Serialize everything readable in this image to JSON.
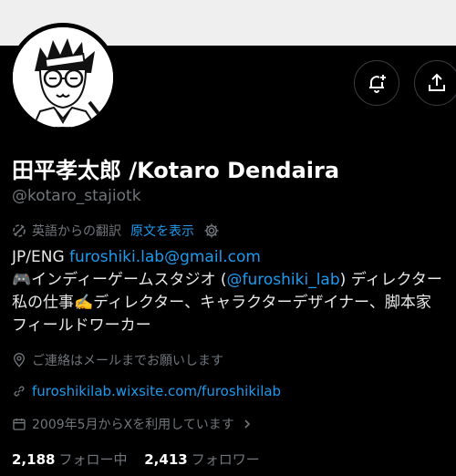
{
  "profile": {
    "display_name": "田平孝太郎 /Kotaro Dendaira",
    "handle": "@kotaro_stajiotk",
    "translation_note": "英語からの翻訳",
    "show_original": "原文を表示",
    "bio": {
      "line1_prefix": "JP/ENG ",
      "line1_email": "furoshiki.lab@gmail.com",
      "line2_prefix": "🎮インディーゲームスタジオ (",
      "line2_mention": "@furoshiki_lab",
      "line2_suffix": ") ディレクター",
      "line3": "私の仕事✍️ディレクター、キャラクターデザイナー、脚本家",
      "line4": "フィールドワーカー"
    },
    "location": "ご連絡はメールまでお願いします",
    "website": "furoshikilab.wixsite.com/furoshikilab",
    "joined": "2009年5月からXを利用しています",
    "following_count": "2,188",
    "following_label": "フォロー中",
    "followers_count": "2,413",
    "followers_label": "フォロワー"
  },
  "icons": {
    "notify": "bell-plus-icon",
    "share": "share-icon",
    "translate": "translate-icon",
    "settings": "gear-icon",
    "location": "location-pin-icon",
    "link": "link-icon",
    "calendar": "calendar-icon",
    "chevron": "chevron-right-icon"
  },
  "colors": {
    "background": "#000000",
    "link": "#1d9bf0",
    "muted": "#71767b",
    "text": "#e7e9ea"
  }
}
